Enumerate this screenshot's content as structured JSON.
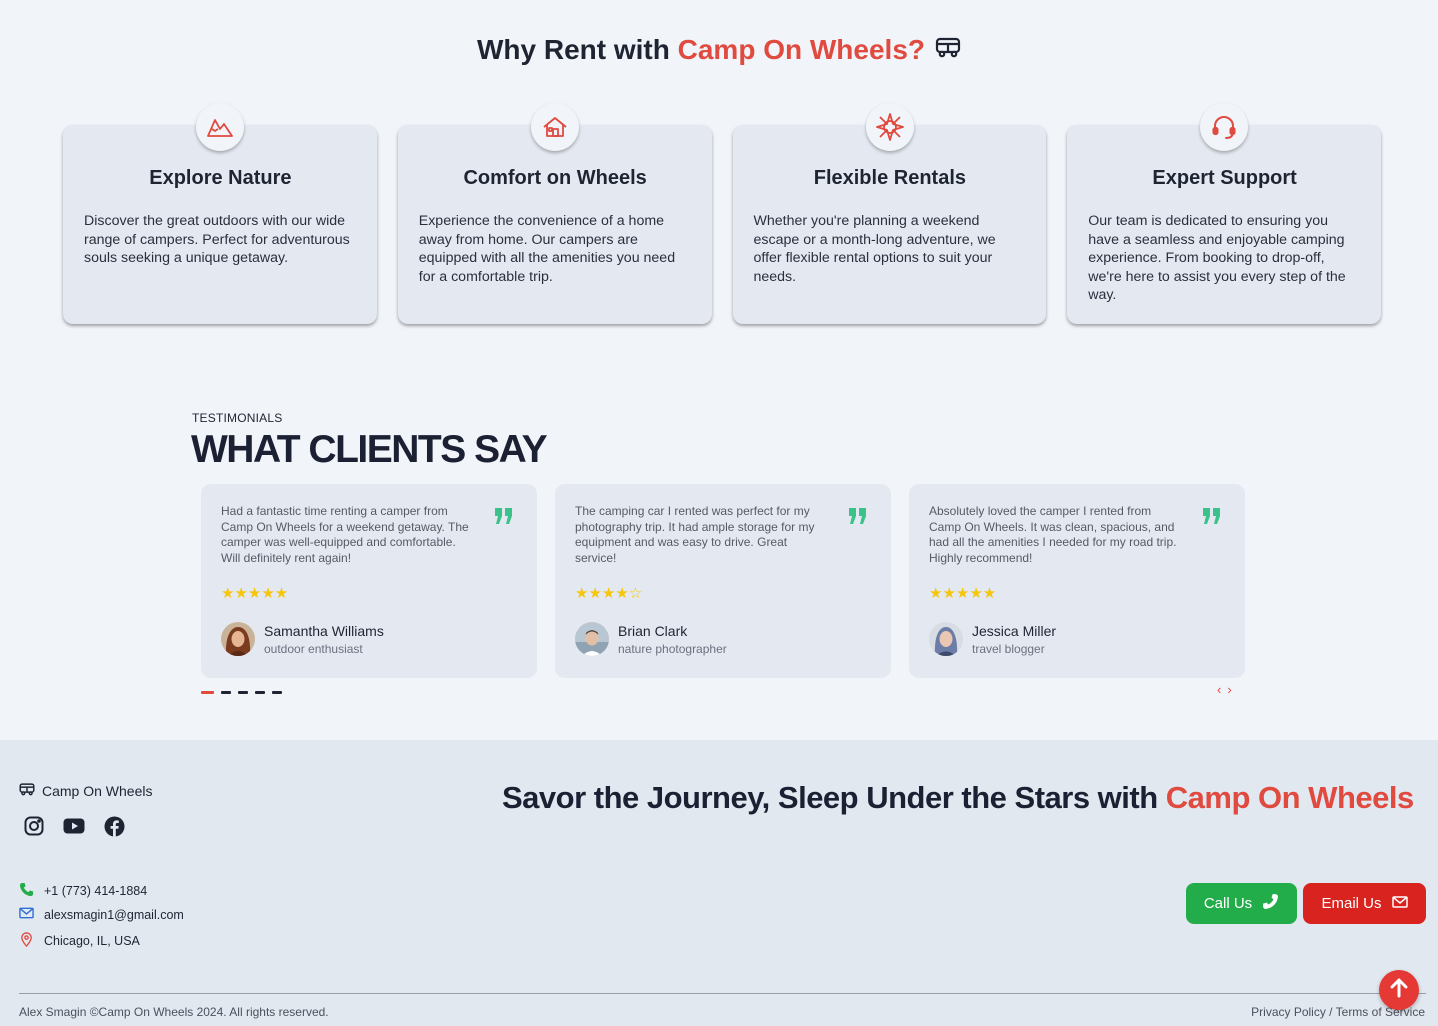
{
  "why": {
    "title_prefix": "Why Rent with ",
    "title_brand": "Camp On Wheels?",
    "features": [
      {
        "title": "Explore Nature",
        "icon": "mountain-icon",
        "text": "Discover the great outdoors with our wide range of campers. Perfect for adventurous souls seeking a unique getaway."
      },
      {
        "title": "Comfort on Wheels",
        "icon": "home-icon",
        "text": "Experience the convenience of a home away from home. Our campers are equipped with all the amenities you need for a comfortable trip."
      },
      {
        "title": "Flexible Rentals",
        "icon": "compass-icon",
        "text": "Whether you're planning a weekend escape or a month-long adventure, we offer flexible rental options to suit your needs."
      },
      {
        "title": "Expert Support",
        "icon": "headset-icon",
        "text": "Our team is dedicated to ensuring you have a seamless and enjoyable camping experience. From booking to drop-off, we're here to assist you every step of the way."
      }
    ]
  },
  "testimonials": {
    "eyebrow": "TESTIMONIALS",
    "heading": "WHAT CLIENTS SAY",
    "items": [
      {
        "quote": "Had a fantastic time renting a camper from Camp On Wheels for a weekend getaway. The camper was well-equipped and comfortable. Will definitely rent again!",
        "rating": 5,
        "stars": "★★★★★",
        "name": "Samantha Williams",
        "role": "outdoor enthusiast"
      },
      {
        "quote": "The camping car I rented was perfect for my photography trip. It had ample storage for my equipment and was easy to drive. Great service!",
        "rating": 4,
        "stars": "★★★★☆",
        "name": "Brian Clark",
        "role": "nature photographer"
      },
      {
        "quote": "Absolutely loved the camper I rented from Camp On Wheels. It was clean, spacious, and had all the amenities I needed for my road trip. Highly recommend!",
        "rating": 5,
        "stars": "★★★★★",
        "name": "Jessica Miller",
        "role": "travel blogger"
      }
    ],
    "pagination_count": 5,
    "active_page": 1,
    "prev": "‹",
    "next": "›"
  },
  "footer": {
    "brand": "Camp On Wheels",
    "tagline_prefix": "Savor the Journey, Sleep Under the Stars with ",
    "tagline_brand": "Camp On Wheels",
    "phone": "+1 (773) 414-1884",
    "email": "alexsmagin1@gmail.com",
    "location": "Chicago, IL, USA",
    "call_label": "Call Us",
    "email_label": "Email Us",
    "copyright": "Alex Smagin ©Camp On Wheels 2024. All rights reserved.",
    "privacy": "Privacy Policy",
    "separator": " / ",
    "terms": "Terms of Service"
  },
  "colors": {
    "accent": "#e04a3f",
    "call_button": "#22ad4a",
    "email_button": "#d9231f",
    "quote_mark": "#3bc18a",
    "star": "#f5c60b"
  }
}
